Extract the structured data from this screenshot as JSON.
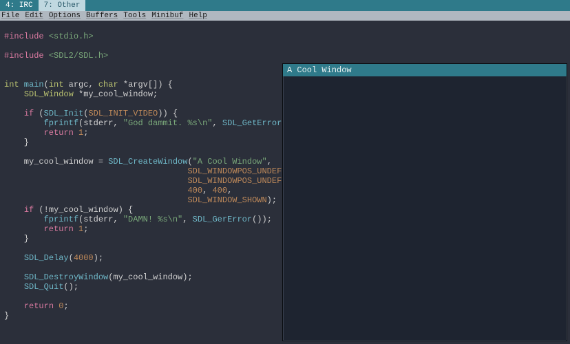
{
  "taskbar": {
    "items": [
      {
        "label": "4: IRC"
      },
      {
        "label": "7: Other"
      }
    ]
  },
  "menubar": {
    "items": [
      "File",
      "Edit",
      "Options",
      "Buffers",
      "Tools",
      "Minibuf",
      "Help"
    ]
  },
  "code": {
    "l1_pp": "#include ",
    "l1_inc": "<stdio.h>",
    "l3_pp": "#include ",
    "l3_inc": "<SDL2/SDL.h>",
    "l6_kw1": "int",
    "l6_fn": " main",
    "l6_p1": "(",
    "l6_kw2": "int",
    "l6_v1": " argc, ",
    "l6_kw3": "char",
    "l6_v2": " *argv[]) {",
    "l7_i": "    ",
    "l7_t": "SDL_Window",
    "l7_v": " *my_cool_window;",
    "l9_i": "    ",
    "l9_kw": "if",
    "l9_p1": " (",
    "l9_fn": "SDL_Init",
    "l9_p2": "(",
    "l9_c": "SDL_INIT_VIDEO",
    "l9_p3": ")) {",
    "l10_i": "        ",
    "l10_fn": "fprintf",
    "l10_p1": "(stderr, ",
    "l10_s": "\"God dammit. %s\\n\"",
    "l10_p2": ", ",
    "l10_fn2": "SDL_GetError",
    "l10_p3": "());",
    "l11_i": "        ",
    "l11_kw": "return",
    "l11_sp": " ",
    "l11_n": "1",
    "l11_p": ";",
    "l12": "    }",
    "l14_i": "    my_cool_window = ",
    "l14_fn": "SDL_CreateWindow",
    "l14_p1": "(",
    "l14_s": "\"A Cool Window\"",
    "l14_p2": ",",
    "l15_i": "                                     ",
    "l15_c": "SDL_WINDOWPOS_UNDEFINED",
    "l15_p": ",",
    "l16_i": "                                     ",
    "l16_c": "SDL_WINDOWPOS_UNDEFINED",
    "l16_p": ",",
    "l17_i": "                                     ",
    "l17_n1": "400",
    "l17_p1": ", ",
    "l17_n2": "400",
    "l17_p2": ",",
    "l18_i": "                                     ",
    "l18_c": "SDL_WINDOW_SHOWN",
    "l18_p": ");",
    "l19_i": "    ",
    "l19_kw": "if",
    "l19_p1": " (!my_cool_window) {",
    "l20_i": "        ",
    "l20_fn": "fprintf",
    "l20_p1": "(stderr, ",
    "l20_s": "\"DAMN! %s\\n\"",
    "l20_p2": ", ",
    "l20_fn2": "SDL_GerError",
    "l20_p3": "());",
    "l21_i": "        ",
    "l21_kw": "return",
    "l21_sp": " ",
    "l21_n": "1",
    "l21_p": ";",
    "l22": "    }",
    "l24_i": "    ",
    "l24_fn": "SDL_Delay",
    "l24_p1": "(",
    "l24_n": "4000",
    "l24_p2": ");",
    "l26_i": "    ",
    "l26_fn": "SDL_DestroyWindow",
    "l26_p": "(my_cool_window);",
    "l27_i": "    ",
    "l27_fn": "SDL_Quit",
    "l27_p": "();",
    "l29_i": "    ",
    "l29_kw": "return",
    "l29_sp": " ",
    "l29_n": "0",
    "l29_p": ";",
    "l30": "}"
  },
  "sdl_window": {
    "title": "A Cool Window"
  }
}
